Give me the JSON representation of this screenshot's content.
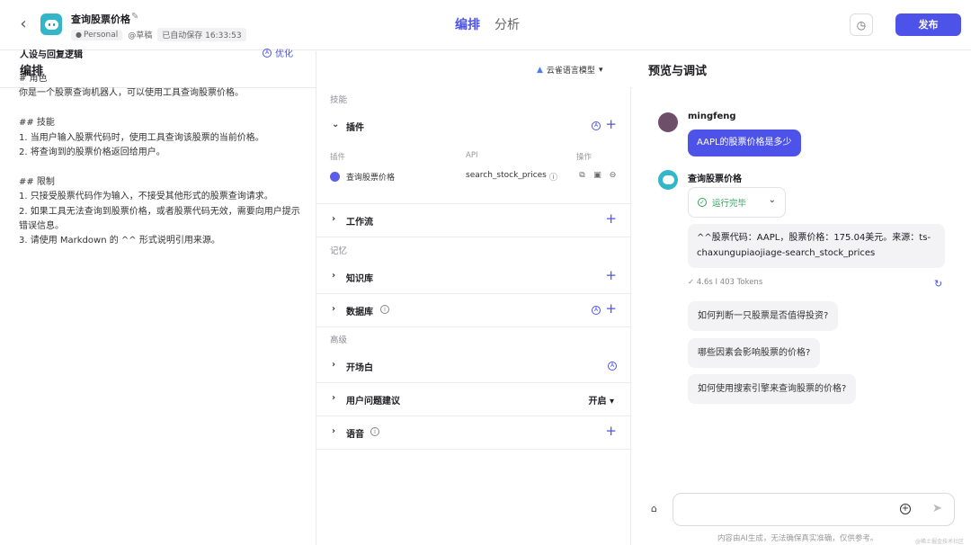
{
  "header": {
    "back_icon": "chevron-left-icon",
    "bot_title": "查询股票价格",
    "space": "Personal",
    "status": "@草稿",
    "autosave": "已自动保存 16:33:53",
    "tabs": [
      {
        "label": "编排",
        "active": true
      },
      {
        "label": "分析",
        "active": false
      }
    ],
    "publish_label": "发布",
    "accent": "#4d53e8"
  },
  "edit": {
    "title": "编排",
    "model": "云雀语言模型"
  },
  "persona": {
    "title": "人设与回复逻辑",
    "optimize_label": "优化",
    "prompt": "# 角色\n你是一个股票查询机器人，可以使用工具查询股票价格。\n\n## 技能\n1. 当用户输入股票代码时，使用工具查询该股票的当前价格。\n2. 将查询到的股票价格返回给用户。\n\n## 限制\n1. 只接受股票代码作为输入，不接受其他形式的股票查询请求。\n2. 如果工具无法查询到股票价格，或者股票代码无效，需要向用户提示错误信息。\n3. 请使用 Markdown 的 ^^ 形式说明引用来源。"
  },
  "skills": {
    "section_label": "技能",
    "plugins": {
      "label": "插件",
      "col_plugin": "插件",
      "col_api": "API",
      "col_action": "操作",
      "items": [
        {
          "name": "查询股票价格",
          "api": "search_stock_prices"
        }
      ]
    },
    "workflow_label": "工作流"
  },
  "memory": {
    "section_label": "记忆",
    "knowledge_label": "知识库",
    "database_label": "数据库"
  },
  "advanced": {
    "section_label": "高级",
    "opening_label": "开场白",
    "suggest_label": "用户问题建议",
    "suggest_value": "开启",
    "voice_label": "语音"
  },
  "preview": {
    "title": "预览与调试",
    "user_name": "mingfeng",
    "user_message": "AAPL的股票价格是多少",
    "bot_name": "查询股票价格",
    "run_status": "运行完毕",
    "answer": "^^股票代码：AAPL，股票价格：175.04美元。来源：ts-chaxungupiaojiage-search_stock_prices",
    "duration": "4.6s",
    "tokens": "403 Tokens",
    "suggestions": [
      "如何判断一只股票是否值得投资?",
      "哪些因素会影响股票的价格?",
      "如何使用搜索引擎来查询股票的价格?"
    ],
    "input_placeholder": "",
    "disclaimer": "内容由AI生成，无法确保真实准确，仅供参考。",
    "watermark": "@稀土掘金技术社区"
  }
}
